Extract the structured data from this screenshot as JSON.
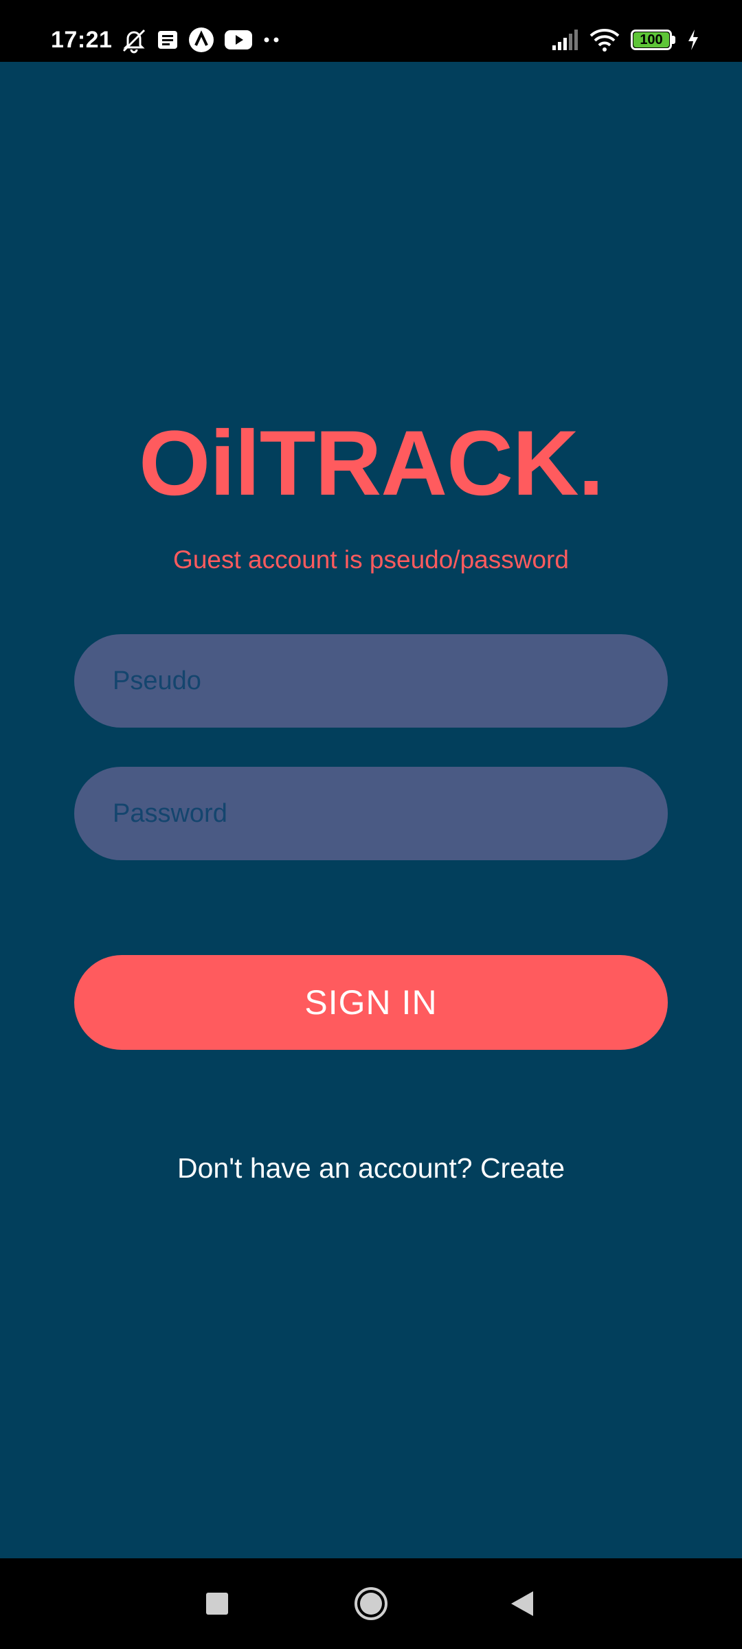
{
  "status_bar": {
    "time": "17:21",
    "icons_left": [
      "mute-icon",
      "notes-icon",
      "app-icon",
      "youtube-icon",
      "more-dots-icon"
    ],
    "icons_right": [
      "signal-icon",
      "wifi-icon",
      "battery-icon",
      "charging-icon"
    ],
    "battery_level": "100"
  },
  "login": {
    "app_name": "OilTRACK.",
    "guest_hint": "Guest account is pseudo/password",
    "pseudo_placeholder": "Pseudo",
    "password_placeholder": "Password",
    "pseudo_value": "",
    "password_value": "",
    "signin_label": "SIGN IN",
    "create_prompt": "Don't have an account?",
    "create_link": "Create"
  },
  "navigation_bar": {
    "buttons": [
      "recents-icon",
      "home-icon",
      "back-icon"
    ]
  },
  "colors": {
    "background": "#023F5C",
    "accent": "#FF5B5E",
    "field_background": "#4A5A84",
    "placeholder": "#14456E",
    "text_light": "#FFFFFF"
  }
}
